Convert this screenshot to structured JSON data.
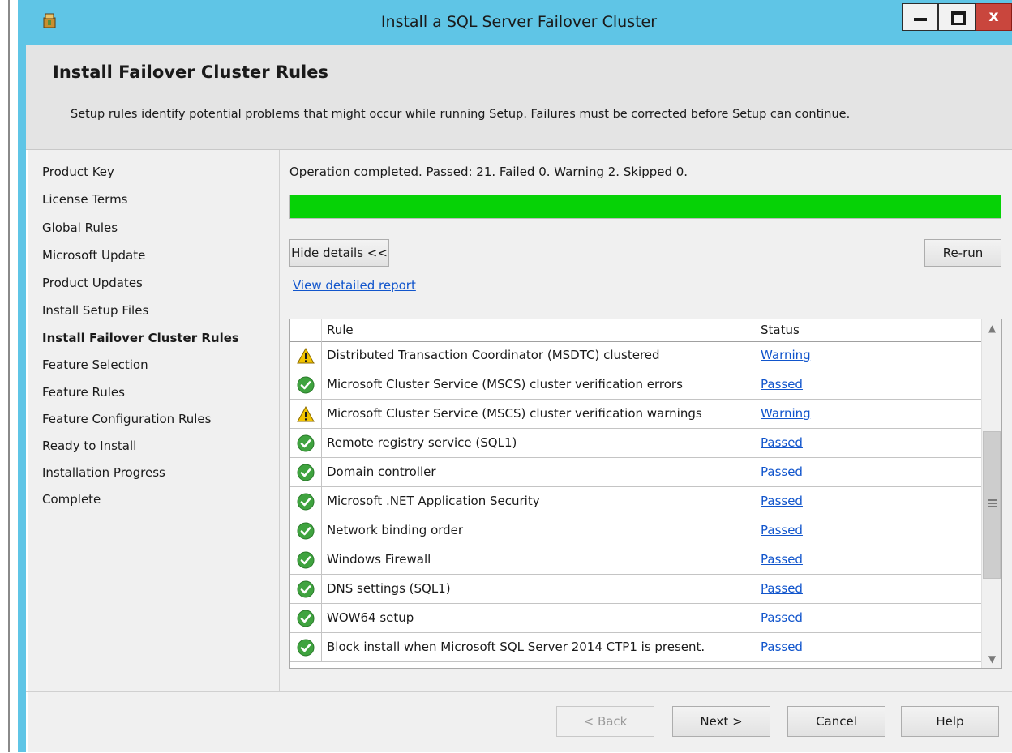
{
  "window": {
    "title": "Install a SQL Server Failover Cluster",
    "controls": {
      "close_glyph": "x"
    }
  },
  "header": {
    "title": "Install Failover Cluster Rules",
    "description": "Setup rules identify potential problems that might occur while running Setup. Failures must be corrected before Setup can continue."
  },
  "nav": {
    "items": [
      {
        "label": "Product Key",
        "active": false
      },
      {
        "label": "License Terms",
        "active": false
      },
      {
        "label": "Global Rules",
        "active": false
      },
      {
        "label": "Microsoft Update",
        "active": false
      },
      {
        "label": "Product Updates",
        "active": false
      },
      {
        "label": "Install Setup Files",
        "active": false
      },
      {
        "label": "Install Failover Cluster Rules",
        "active": true
      },
      {
        "label": "Feature Selection",
        "active": false
      },
      {
        "label": "Feature Rules",
        "active": false
      },
      {
        "label": "Feature Configuration Rules",
        "active": false
      },
      {
        "label": "Ready to Install",
        "active": false
      },
      {
        "label": "Installation Progress",
        "active": false
      },
      {
        "label": "Complete",
        "active": false
      }
    ]
  },
  "main": {
    "status_text": "Operation completed. Passed: 21.   Failed 0.   Warning 2.   Skipped 0.",
    "progress": {
      "percent": 100,
      "color": "#06d206"
    },
    "hide_details_label": "Hide details <<",
    "rerun_label": "Re-run",
    "report_link": "View detailed report",
    "grid": {
      "columns": [
        "Rule",
        "Status"
      ],
      "rows": [
        {
          "icon": "warning-icon",
          "rule": "Distributed Transaction Coordinator (MSDTC) clustered",
          "status": "Warning"
        },
        {
          "icon": "passed-icon",
          "rule": "Microsoft Cluster Service (MSCS) cluster verification errors",
          "status": "Passed"
        },
        {
          "icon": "warning-icon",
          "rule": "Microsoft Cluster Service (MSCS) cluster verification warnings",
          "status": "Warning"
        },
        {
          "icon": "passed-icon",
          "rule": "Remote registry service (SQL1)",
          "status": "Passed"
        },
        {
          "icon": "passed-icon",
          "rule": "Domain controller",
          "status": "Passed"
        },
        {
          "icon": "passed-icon",
          "rule": "Microsoft .NET Application Security",
          "status": "Passed"
        },
        {
          "icon": "passed-icon",
          "rule": "Network binding order",
          "status": "Passed"
        },
        {
          "icon": "passed-icon",
          "rule": "Windows Firewall",
          "status": "Passed"
        },
        {
          "icon": "passed-icon",
          "rule": "DNS settings (SQL1)",
          "status": "Passed"
        },
        {
          "icon": "passed-icon",
          "rule": "WOW64 setup",
          "status": "Passed"
        },
        {
          "icon": "passed-icon",
          "rule": "Block install when Microsoft SQL Server 2014 CTP1 is present.",
          "status": "Passed"
        }
      ]
    }
  },
  "footer": {
    "back_label": "< Back",
    "next_label": "Next >",
    "cancel_label": "Cancel",
    "help_label": "Help"
  },
  "colors": {
    "titlebar": "#5fc5e6",
    "link": "#1155cc",
    "passed": "#3fa33f",
    "warning": "#f2c400"
  }
}
